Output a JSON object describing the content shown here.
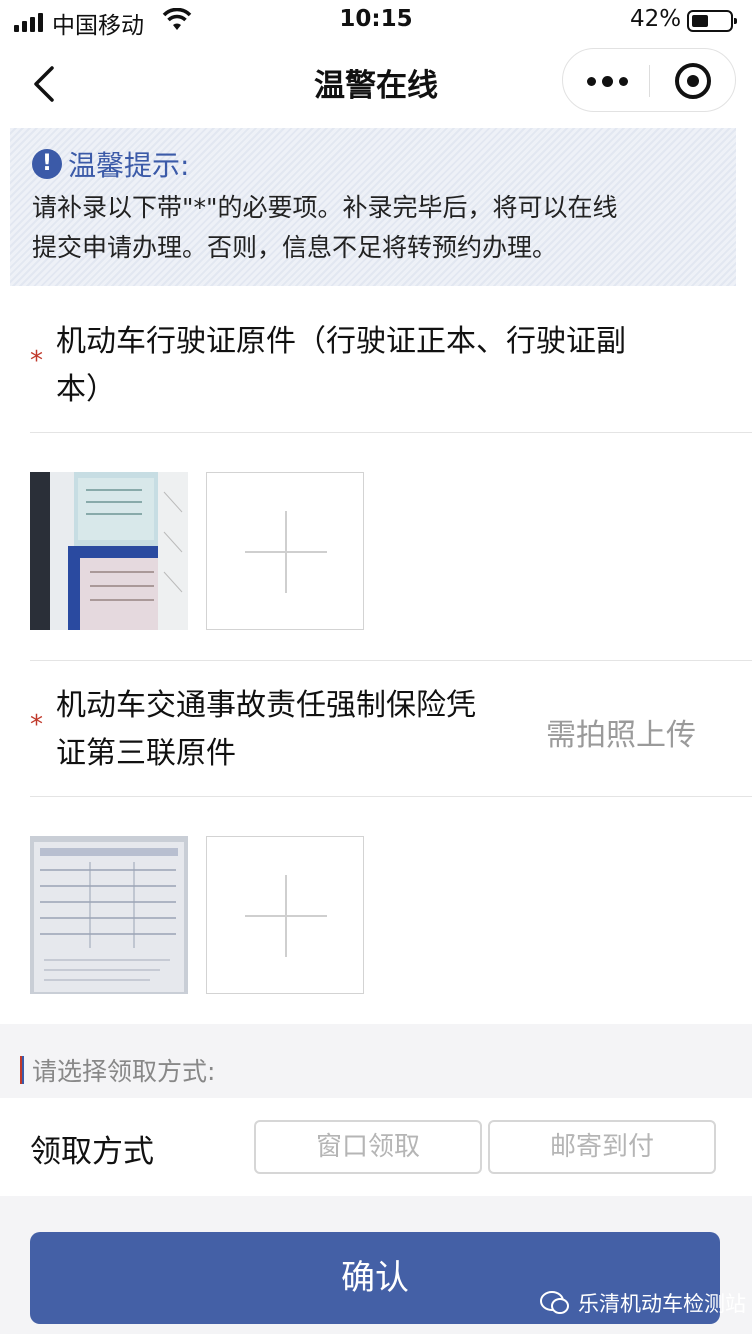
{
  "status_bar": {
    "carrier": "中国移动",
    "time": "10:15",
    "battery": "42%"
  },
  "nav": {
    "title": "温警在线",
    "back_icon": "chevron-left-icon",
    "more_icon": "more-dots-icon",
    "close_icon": "target-circle-icon"
  },
  "tip": {
    "title": "温馨提示:",
    "line1": "请补录以下带\"*\"的必要项。补录完毕后，将可以在线",
    "line2": "提交申请办理。否则，信息不足将转预约办理。"
  },
  "section1": {
    "star": "*",
    "label_line1": "机动车行驶证原件（行驶证正本、行驶证副",
    "label_line2": "本）"
  },
  "section2": {
    "star": "*",
    "label_line1": "机动车交通事故责任强制保险凭",
    "label_line2": "证第三联原件",
    "hint": "需拍照上传"
  },
  "pickup": {
    "title": "请选择领取方式:",
    "label": "领取方式",
    "options": [
      "窗口领取",
      "邮寄到付"
    ]
  },
  "confirm_label": "确认",
  "watermark": "乐清机动车检测站",
  "colors": {
    "accent": "#4460a6",
    "tip_text": "#3b5aa8",
    "required": "#c0392b"
  }
}
